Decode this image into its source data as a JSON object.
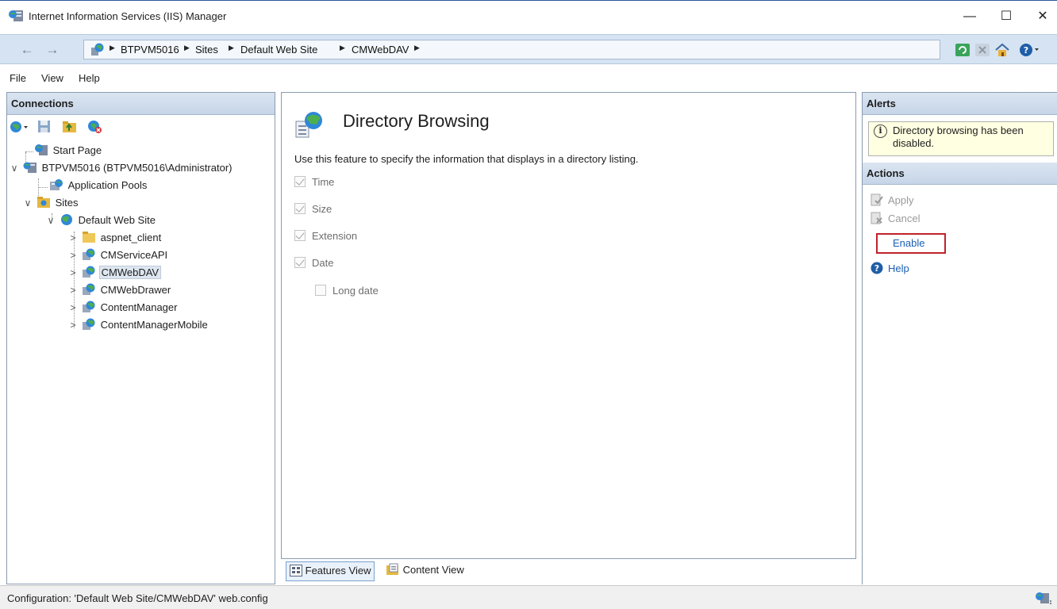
{
  "window": {
    "title": "Internet Information Services (IIS) Manager"
  },
  "address": {
    "segments": [
      "BTPVM5016",
      "Sites",
      "Default Web Site",
      "CMWebDAV"
    ]
  },
  "menu": {
    "items": [
      "File",
      "View",
      "Help"
    ]
  },
  "connections": {
    "header": "Connections",
    "tree": {
      "start_page": "Start Page",
      "server": "BTPVM5016 (BTPVM5016\\Administrator)",
      "app_pools": "Application Pools",
      "sites": "Sites",
      "default_site": "Default Web Site",
      "children": [
        "aspnet_client",
        "CMServiceAPI",
        "CMWebDAV",
        "CMWebDrawer",
        "ContentManager",
        "ContentManagerMobile"
      ]
    }
  },
  "main": {
    "title": "Directory Browsing",
    "description": "Use this feature to specify the information that displays in a directory listing.",
    "options": [
      {
        "label": "Time",
        "checked": true
      },
      {
        "label": "Size",
        "checked": true
      },
      {
        "label": "Extension",
        "checked": true
      },
      {
        "label": "Date",
        "checked": true
      },
      {
        "label": "Long date",
        "checked": false
      }
    ],
    "views": {
      "features": "Features View",
      "content": "Content View"
    }
  },
  "alerts": {
    "header": "Alerts",
    "message": "Directory browsing has been disabled."
  },
  "actions": {
    "header": "Actions",
    "apply": "Apply",
    "cancel": "Cancel",
    "enable": "Enable",
    "help": "Help"
  },
  "status": {
    "text": "Configuration: 'Default Web Site/CMWebDAV' web.config"
  },
  "colors": {
    "accent": "#2b579a",
    "highlight_box": "#c0232a",
    "link": "#1a5fb4"
  }
}
